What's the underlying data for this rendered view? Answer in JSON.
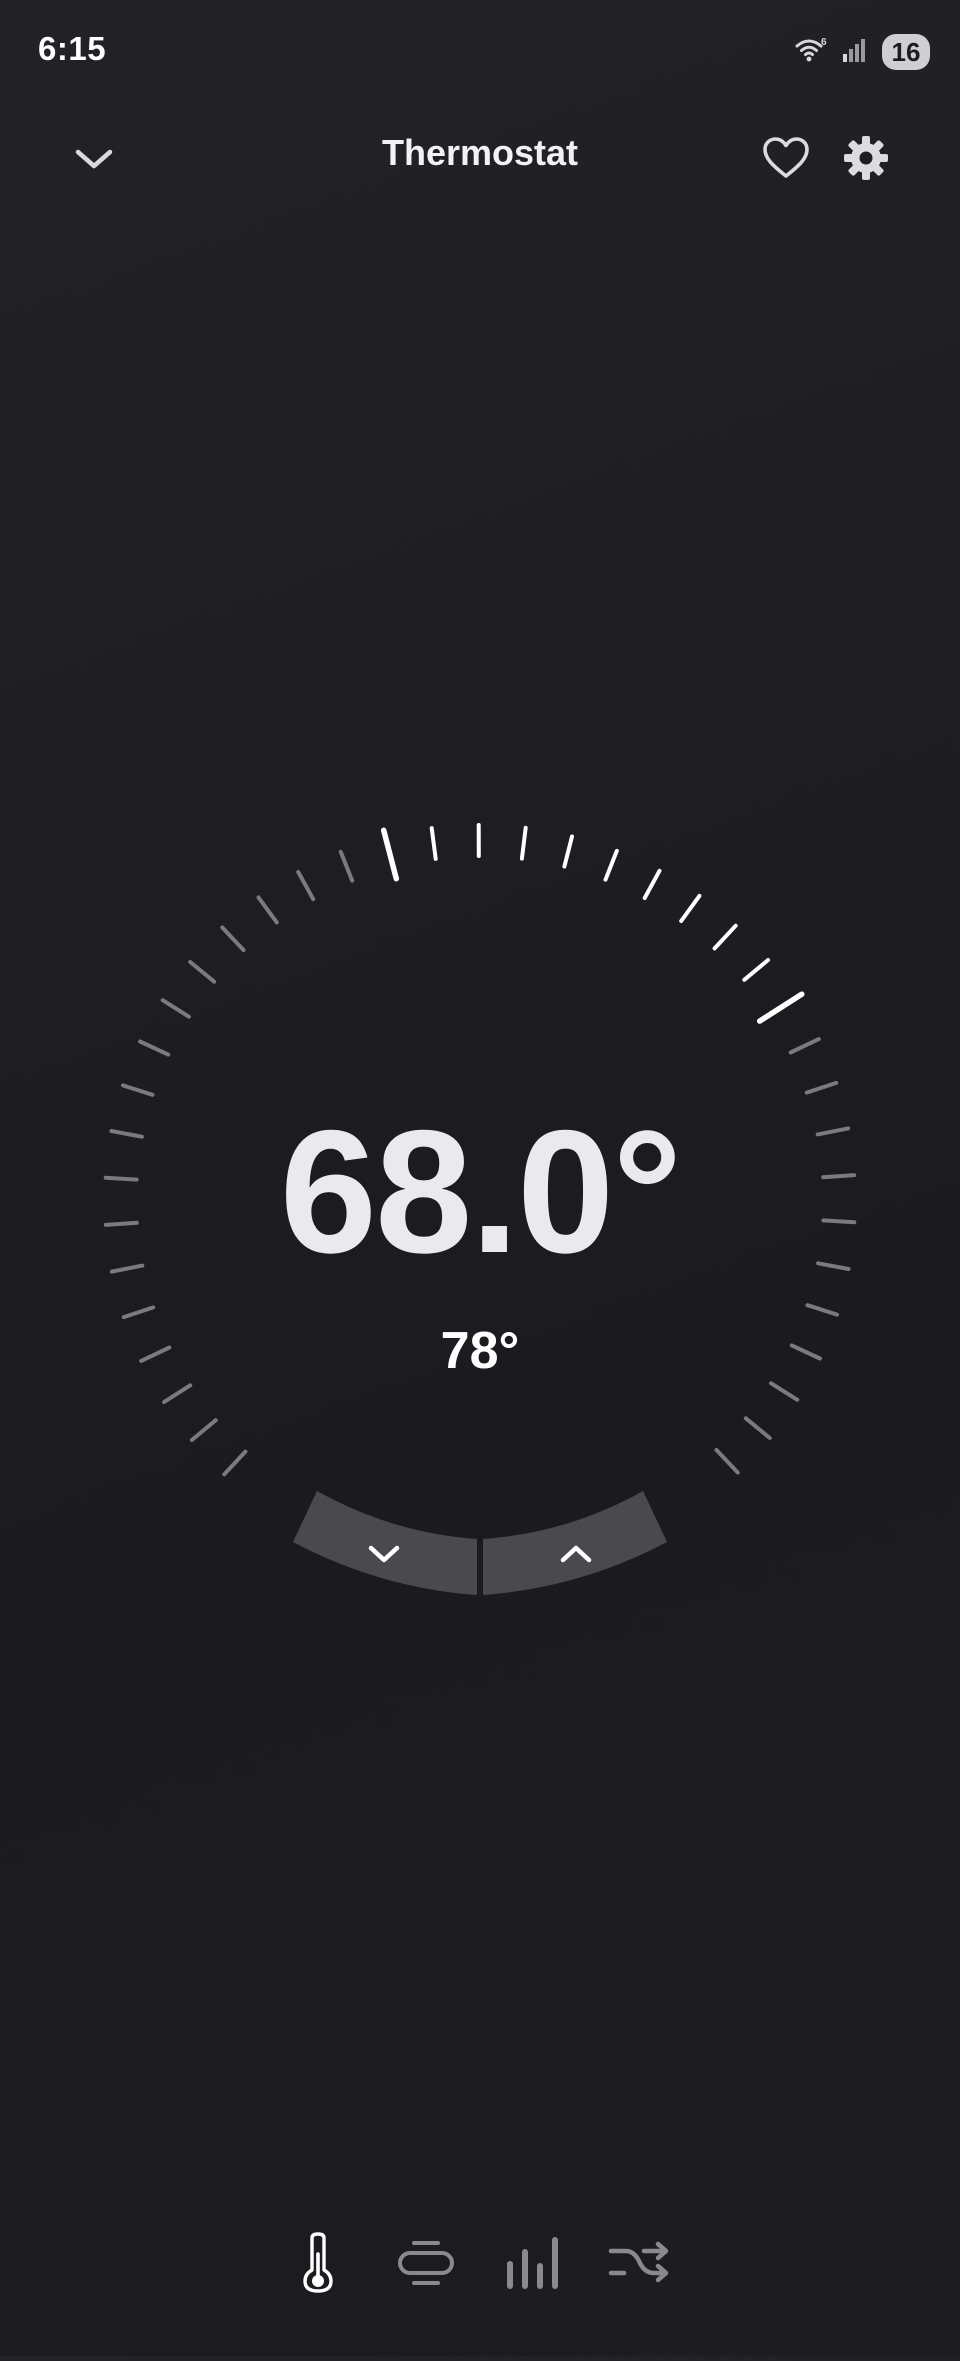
{
  "status_bar": {
    "time": "6:15",
    "battery": "16",
    "wifi_icon": "wifi-6-icon",
    "signal_icon": "cellular-signal-icon"
  },
  "header": {
    "title": "Thermostat",
    "back_icon": "chevron-down-icon",
    "favorite_icon": "heart-outline-icon",
    "settings_icon": "gear-icon"
  },
  "thermostat": {
    "current_temperature": "68.0°",
    "setpoint_temperature": "78°",
    "decrease_icon": "chevron-down-icon",
    "increase_icon": "chevron-up-icon"
  },
  "bottom_nav": {
    "items": [
      {
        "icon": "thermometer-icon",
        "active": true
      },
      {
        "icon": "fan-mode-icon",
        "active": false
      },
      {
        "icon": "bar-chart-icon",
        "active": false
      },
      {
        "icon": "shuffle-icon",
        "active": false
      }
    ]
  },
  "colors": {
    "background": "#1e1e22",
    "text_primary": "#e9e9ee",
    "tick_active": "#ffffff",
    "tick_inactive": "#7a7a7f",
    "stepper": "#49494d"
  }
}
